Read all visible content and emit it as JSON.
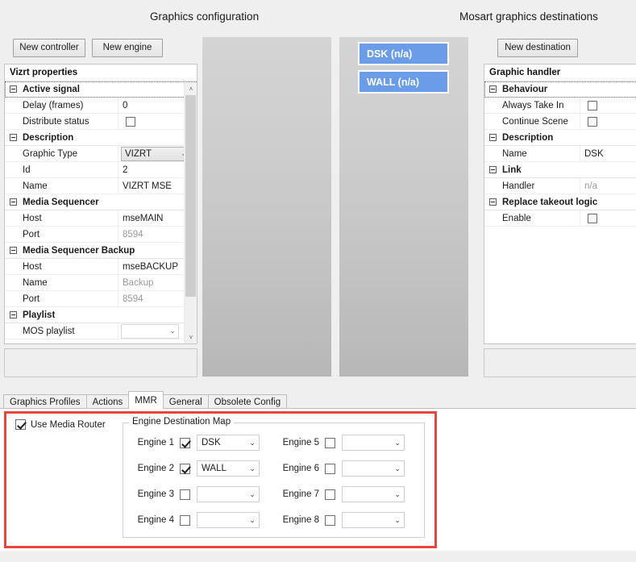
{
  "headers": {
    "left_title": "Graphics configuration",
    "right_title": "Mosart graphics destinations"
  },
  "toolbar": {
    "new_controller": "New controller",
    "new_engine": "New engine",
    "new_destination": "New destination"
  },
  "left_grid": {
    "title": "Vizrt properties",
    "rows": [
      {
        "kind": "category",
        "label": "Active signal",
        "focused": true
      },
      {
        "kind": "prop",
        "name": "Delay (frames)",
        "value": "0",
        "value_kind": "text"
      },
      {
        "kind": "prop",
        "name": "Distribute status",
        "value": "",
        "value_kind": "checkbox",
        "checked": false
      },
      {
        "kind": "category",
        "label": "Description",
        "focused": false
      },
      {
        "kind": "prop",
        "name": "Graphic Type",
        "value": "VIZRT",
        "value_kind": "combo"
      },
      {
        "kind": "prop",
        "name": "Id",
        "value": "2",
        "value_kind": "text"
      },
      {
        "kind": "prop",
        "name": "Name",
        "value": "VIZRT MSE",
        "value_kind": "text"
      },
      {
        "kind": "category",
        "label": "Media Sequencer",
        "focused": false
      },
      {
        "kind": "prop",
        "name": "Host",
        "value": "mseMAIN",
        "value_kind": "text"
      },
      {
        "kind": "prop",
        "name": "Port",
        "value": "8594",
        "value_kind": "text",
        "dim": true
      },
      {
        "kind": "category",
        "label": "Media Sequencer Backup",
        "focused": false
      },
      {
        "kind": "prop",
        "name": "Host",
        "value": "mseBACKUP",
        "value_kind": "text"
      },
      {
        "kind": "prop",
        "name": "Name",
        "value": "Backup",
        "value_kind": "text",
        "dim": true
      },
      {
        "kind": "prop",
        "name": "Port",
        "value": "8594",
        "value_kind": "text",
        "dim": true
      },
      {
        "kind": "category",
        "label": "Playlist",
        "focused": false
      },
      {
        "kind": "prop",
        "name": "MOS playlist",
        "value": "",
        "value_kind": "combo_empty"
      }
    ]
  },
  "destinations": {
    "items": [
      {
        "label": "DSK (n/a)"
      },
      {
        "label": "WALL (n/a)"
      }
    ]
  },
  "right_grid": {
    "title": "Graphic handler",
    "rows": [
      {
        "kind": "category",
        "label": "Behaviour",
        "focused": true
      },
      {
        "kind": "prop",
        "name": "Always Take In",
        "value": "",
        "value_kind": "checkbox",
        "checked": false
      },
      {
        "kind": "prop",
        "name": "Continue Scene",
        "value": "",
        "value_kind": "checkbox",
        "checked": false
      },
      {
        "kind": "category",
        "label": "Description",
        "focused": false
      },
      {
        "kind": "prop",
        "name": "Name",
        "value": "DSK",
        "value_kind": "text"
      },
      {
        "kind": "category",
        "label": "Link",
        "focused": false
      },
      {
        "kind": "prop",
        "name": "Handler",
        "value": "n/a",
        "value_kind": "text",
        "dim": true
      },
      {
        "kind": "category",
        "label": "Replace takeout logic",
        "focused": false
      },
      {
        "kind": "prop",
        "name": "Enable",
        "value": "",
        "value_kind": "checkbox",
        "checked": false
      }
    ]
  },
  "tabs": [
    {
      "label": "Graphics Profiles",
      "active": false
    },
    {
      "label": "Actions",
      "active": false
    },
    {
      "label": "MMR",
      "active": true
    },
    {
      "label": "General",
      "active": false
    },
    {
      "label": "Obsolete Config",
      "active": false
    }
  ],
  "mmr": {
    "use_media_router": {
      "label": "Use Media Router",
      "checked": true
    },
    "group_legend": "Engine Destination Map",
    "engines_left": [
      {
        "label": "Engine 1",
        "checked": true,
        "destination": "DSK"
      },
      {
        "label": "Engine 2",
        "checked": true,
        "destination": "WALL"
      },
      {
        "label": "Engine 3",
        "checked": false,
        "destination": ""
      },
      {
        "label": "Engine 4",
        "checked": false,
        "destination": ""
      }
    ],
    "engines_right": [
      {
        "label": "Engine 5",
        "checked": false,
        "destination": ""
      },
      {
        "label": "Engine 6",
        "checked": false,
        "destination": ""
      },
      {
        "label": "Engine 7",
        "checked": false,
        "destination": ""
      },
      {
        "label": "Engine 8",
        "checked": false,
        "destination": ""
      }
    ]
  },
  "icons": {
    "chevron_down": "⌄",
    "scroll_up": "˄",
    "scroll_down": "˅",
    "expander_minus": "−"
  },
  "colors": {
    "accent_blue": "#6a9ce8",
    "highlight_red": "#e8453c",
    "panel_gray": "#efefef",
    "canvas_gray": "#c6c6c6"
  }
}
